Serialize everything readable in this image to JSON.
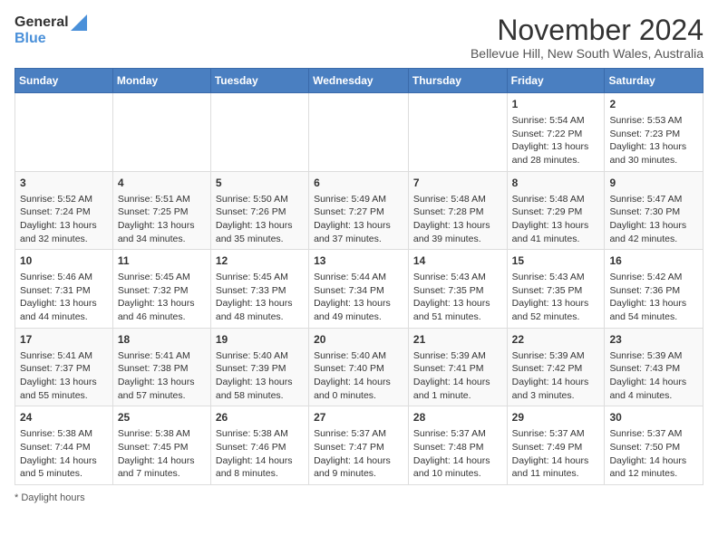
{
  "header": {
    "logo_general": "General",
    "logo_blue": "Blue",
    "title": "November 2024",
    "subtitle": "Bellevue Hill, New South Wales, Australia"
  },
  "calendar": {
    "days_of_week": [
      "Sunday",
      "Monday",
      "Tuesday",
      "Wednesday",
      "Thursday",
      "Friday",
      "Saturday"
    ],
    "weeks": [
      [
        {
          "day": "",
          "info": ""
        },
        {
          "day": "",
          "info": ""
        },
        {
          "day": "",
          "info": ""
        },
        {
          "day": "",
          "info": ""
        },
        {
          "day": "",
          "info": ""
        },
        {
          "day": "1",
          "info": "Sunrise: 5:54 AM\nSunset: 7:22 PM\nDaylight: 13 hours and 28 minutes."
        },
        {
          "day": "2",
          "info": "Sunrise: 5:53 AM\nSunset: 7:23 PM\nDaylight: 13 hours and 30 minutes."
        }
      ],
      [
        {
          "day": "3",
          "info": "Sunrise: 5:52 AM\nSunset: 7:24 PM\nDaylight: 13 hours and 32 minutes."
        },
        {
          "day": "4",
          "info": "Sunrise: 5:51 AM\nSunset: 7:25 PM\nDaylight: 13 hours and 34 minutes."
        },
        {
          "day": "5",
          "info": "Sunrise: 5:50 AM\nSunset: 7:26 PM\nDaylight: 13 hours and 35 minutes."
        },
        {
          "day": "6",
          "info": "Sunrise: 5:49 AM\nSunset: 7:27 PM\nDaylight: 13 hours and 37 minutes."
        },
        {
          "day": "7",
          "info": "Sunrise: 5:48 AM\nSunset: 7:28 PM\nDaylight: 13 hours and 39 minutes."
        },
        {
          "day": "8",
          "info": "Sunrise: 5:48 AM\nSunset: 7:29 PM\nDaylight: 13 hours and 41 minutes."
        },
        {
          "day": "9",
          "info": "Sunrise: 5:47 AM\nSunset: 7:30 PM\nDaylight: 13 hours and 42 minutes."
        }
      ],
      [
        {
          "day": "10",
          "info": "Sunrise: 5:46 AM\nSunset: 7:31 PM\nDaylight: 13 hours and 44 minutes."
        },
        {
          "day": "11",
          "info": "Sunrise: 5:45 AM\nSunset: 7:32 PM\nDaylight: 13 hours and 46 minutes."
        },
        {
          "day": "12",
          "info": "Sunrise: 5:45 AM\nSunset: 7:33 PM\nDaylight: 13 hours and 48 minutes."
        },
        {
          "day": "13",
          "info": "Sunrise: 5:44 AM\nSunset: 7:34 PM\nDaylight: 13 hours and 49 minutes."
        },
        {
          "day": "14",
          "info": "Sunrise: 5:43 AM\nSunset: 7:35 PM\nDaylight: 13 hours and 51 minutes."
        },
        {
          "day": "15",
          "info": "Sunrise: 5:43 AM\nSunset: 7:35 PM\nDaylight: 13 hours and 52 minutes."
        },
        {
          "day": "16",
          "info": "Sunrise: 5:42 AM\nSunset: 7:36 PM\nDaylight: 13 hours and 54 minutes."
        }
      ],
      [
        {
          "day": "17",
          "info": "Sunrise: 5:41 AM\nSunset: 7:37 PM\nDaylight: 13 hours and 55 minutes."
        },
        {
          "day": "18",
          "info": "Sunrise: 5:41 AM\nSunset: 7:38 PM\nDaylight: 13 hours and 57 minutes."
        },
        {
          "day": "19",
          "info": "Sunrise: 5:40 AM\nSunset: 7:39 PM\nDaylight: 13 hours and 58 minutes."
        },
        {
          "day": "20",
          "info": "Sunrise: 5:40 AM\nSunset: 7:40 PM\nDaylight: 14 hours and 0 minutes."
        },
        {
          "day": "21",
          "info": "Sunrise: 5:39 AM\nSunset: 7:41 PM\nDaylight: 14 hours and 1 minute."
        },
        {
          "day": "22",
          "info": "Sunrise: 5:39 AM\nSunset: 7:42 PM\nDaylight: 14 hours and 3 minutes."
        },
        {
          "day": "23",
          "info": "Sunrise: 5:39 AM\nSunset: 7:43 PM\nDaylight: 14 hours and 4 minutes."
        }
      ],
      [
        {
          "day": "24",
          "info": "Sunrise: 5:38 AM\nSunset: 7:44 PM\nDaylight: 14 hours and 5 minutes."
        },
        {
          "day": "25",
          "info": "Sunrise: 5:38 AM\nSunset: 7:45 PM\nDaylight: 14 hours and 7 minutes."
        },
        {
          "day": "26",
          "info": "Sunrise: 5:38 AM\nSunset: 7:46 PM\nDaylight: 14 hours and 8 minutes."
        },
        {
          "day": "27",
          "info": "Sunrise: 5:37 AM\nSunset: 7:47 PM\nDaylight: 14 hours and 9 minutes."
        },
        {
          "day": "28",
          "info": "Sunrise: 5:37 AM\nSunset: 7:48 PM\nDaylight: 14 hours and 10 minutes."
        },
        {
          "day": "29",
          "info": "Sunrise: 5:37 AM\nSunset: 7:49 PM\nDaylight: 14 hours and 11 minutes."
        },
        {
          "day": "30",
          "info": "Sunrise: 5:37 AM\nSunset: 7:50 PM\nDaylight: 14 hours and 12 minutes."
        }
      ]
    ]
  },
  "footer": {
    "note": "Daylight hours"
  }
}
